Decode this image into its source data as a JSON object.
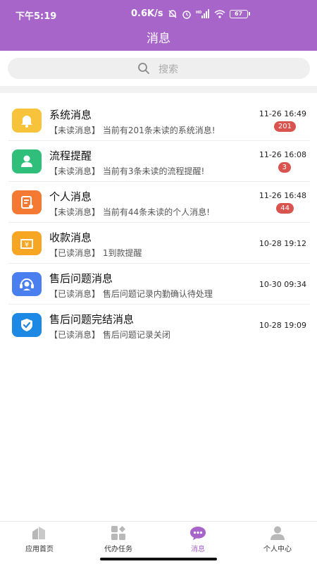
{
  "status_bar": {
    "time": "下午5:19",
    "speed": "0.6K/s",
    "signal_label": "HD",
    "battery": "67"
  },
  "header": {
    "title": "消息"
  },
  "search": {
    "placeholder": "搜索"
  },
  "messages": [
    {
      "title": "系统消息",
      "subtitle": "【未读消息】 当前有201条未读的系统消息!",
      "time": "11-26 16:49",
      "badge": "201",
      "icon": "bell-icon",
      "color": "#f6c33b"
    },
    {
      "title": "流程提醒",
      "subtitle": "【未读消息】 当前有3条未读的流程提醒!",
      "time": "11-26 16:08",
      "badge": "3",
      "icon": "person-icon",
      "color": "#2fbf7a"
    },
    {
      "title": "个人消息",
      "subtitle": "【未读消息】 当前有44条未读的个人消息!",
      "time": "11-26 16:48",
      "badge": "44",
      "icon": "document-icon",
      "color": "#f47a34"
    },
    {
      "title": "收款消息",
      "subtitle": "【已读消息】 1到款提醒",
      "time": "10-28 19:12",
      "badge": "",
      "icon": "yen-wallet-icon",
      "color": "#f6a623"
    },
    {
      "title": "售后问题消息",
      "subtitle": "【已读消息】 售后问题记录内勤确认待处理",
      "time": "10-30 09:34",
      "badge": "",
      "icon": "headset-icon",
      "color": "#4a7ff0"
    },
    {
      "title": "售后问题完结消息",
      "subtitle": "【已读消息】 售后问题记录关闭",
      "time": "10-28 19:09",
      "badge": "",
      "icon": "shield-check-icon",
      "color": "#1e88e5"
    }
  ],
  "tabs": [
    {
      "label": "应用首页",
      "icon": "home-icon",
      "active": false
    },
    {
      "label": "代办任务",
      "icon": "grid-icon",
      "active": false
    },
    {
      "label": "消息",
      "icon": "chat-bubble-icon",
      "active": true
    },
    {
      "label": "个人中心",
      "icon": "profile-icon",
      "active": false
    }
  ],
  "colors": {
    "accent": "#a865c9",
    "badge": "#d9534f",
    "inactive_icon": "#b8b8b8"
  }
}
